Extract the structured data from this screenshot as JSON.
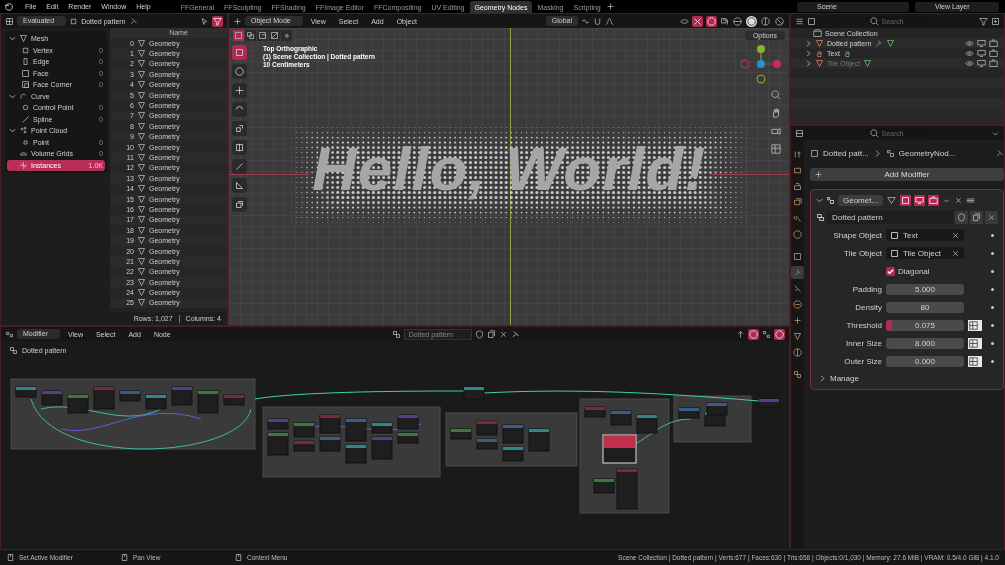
{
  "menu": [
    "File",
    "Edit",
    "Render",
    "Window",
    "Help"
  ],
  "workspaces": [
    {
      "label": "FFGeneral",
      "selected": false
    },
    {
      "label": "FFSculpting",
      "selected": false
    },
    {
      "label": "FFShading",
      "selected": false
    },
    {
      "label": "FFImage Editor",
      "selected": false
    },
    {
      "label": "FFCompositing",
      "selected": false
    },
    {
      "label": "UV Editing",
      "selected": false
    },
    {
      "label": "Geometry Nodes",
      "selected": true
    },
    {
      "label": "Masking",
      "selected": false
    },
    {
      "label": "Scripting",
      "selected": false
    }
  ],
  "scene": "Scene",
  "view_layer": "View Layer",
  "spreadsheet": {
    "display": "Evaluated",
    "object": "Dotted pattern",
    "tree": [
      {
        "label": "Mesh",
        "kind": "mesh",
        "expanded": true,
        "selected": false,
        "children": [
          {
            "label": "Vertex",
            "kind": "vertex",
            "count": "0",
            "selected": false
          },
          {
            "label": "Edge",
            "kind": "edge",
            "count": "0",
            "selected": false
          },
          {
            "label": "Face",
            "kind": "face",
            "count": "0",
            "selected": false
          },
          {
            "label": "Face Corner",
            "kind": "corner",
            "count": "0",
            "selected": false
          }
        ]
      },
      {
        "label": "Curve",
        "kind": "curve",
        "expanded": true,
        "selected": false,
        "children": [
          {
            "label": "Control Point",
            "kind": "control_point",
            "count": "0",
            "selected": false
          },
          {
            "label": "Spline",
            "kind": "spline",
            "count": "0",
            "selected": false
          }
        ]
      },
      {
        "label": "Point Cloud",
        "kind": "point_cloud",
        "expanded": true,
        "selected": false,
        "children": [
          {
            "label": "Point",
            "kind": "point",
            "count": "0",
            "selected": false
          }
        ]
      },
      {
        "label": "Volume Grids",
        "kind": "volume",
        "count": "0",
        "selected": false
      },
      {
        "label": "Instances",
        "kind": "instances",
        "count": "1.0K",
        "selected": true
      }
    ],
    "column": "Name",
    "rows": [
      {
        "index": "0",
        "name": "Geometry"
      },
      {
        "index": "1",
        "name": "Geometry"
      },
      {
        "index": "2",
        "name": "Geometry"
      },
      {
        "index": "3",
        "name": "Geometry"
      },
      {
        "index": "4",
        "name": "Geometry"
      },
      {
        "index": "5",
        "name": "Geometry"
      },
      {
        "index": "6",
        "name": "Geometry"
      },
      {
        "index": "7",
        "name": "Geometry"
      },
      {
        "index": "8",
        "name": "Geometry"
      },
      {
        "index": "9",
        "name": "Geometry"
      },
      {
        "index": "10",
        "name": "Geometry"
      },
      {
        "index": "11",
        "name": "Geometry"
      },
      {
        "index": "12",
        "name": "Geometry"
      },
      {
        "index": "13",
        "name": "Geometry"
      },
      {
        "index": "14",
        "name": "Geometry"
      },
      {
        "index": "15",
        "name": "Geometry"
      },
      {
        "index": "16",
        "name": "Geometry"
      },
      {
        "index": "17",
        "name": "Geometry"
      },
      {
        "index": "18",
        "name": "Geometry"
      },
      {
        "index": "19",
        "name": "Geometry"
      },
      {
        "index": "20",
        "name": "Geometry"
      },
      {
        "index": "21",
        "name": "Geometry"
      },
      {
        "index": "22",
        "name": "Geometry"
      },
      {
        "index": "23",
        "name": "Geometry"
      },
      {
        "index": "24",
        "name": "Geometry"
      },
      {
        "index": "25",
        "name": "Geometry"
      }
    ],
    "rows_count": "Rows: 1,027",
    "columns_count": "Columns: 4"
  },
  "viewport": {
    "mode": "Object Mode",
    "menus": [
      "View",
      "Select",
      "Add",
      "Object"
    ],
    "orientation": "Global",
    "options": "Options",
    "select_modes": [
      {
        "kind": "set",
        "selected": true
      },
      {
        "kind": "extend",
        "selected": false
      },
      {
        "kind": "subtract",
        "selected": false
      },
      {
        "kind": "invert",
        "selected": false
      },
      {
        "kind": "intersect",
        "selected": false
      }
    ],
    "shading": [
      {
        "kind": "wireframe",
        "selected": false
      },
      {
        "kind": "solid",
        "selected": true
      },
      {
        "kind": "material",
        "selected": false
      },
      {
        "kind": "rendered",
        "selected": false
      }
    ],
    "tools": [
      {
        "kind": "select",
        "selected": true
      },
      {
        "kind": "cursor",
        "selected": false
      },
      {
        "kind": "move",
        "selected": false
      },
      {
        "kind": "rotate",
        "selected": false
      },
      {
        "kind": "scale",
        "selected": false
      },
      {
        "kind": "transform",
        "selected": false
      },
      {
        "kind": "annotate",
        "selected": false
      },
      {
        "kind": "measure",
        "selected": false
      },
      {
        "kind": "add_cube",
        "selected": false
      }
    ],
    "view_name": "Top Orthographic",
    "collection": "(1) Scene Collection | Dotted pattern",
    "scale": "10 Centimeters",
    "text": "Hello, World!"
  },
  "outliner": {
    "search": {
      "placeholder": "Search"
    },
    "root": "Scene Collection",
    "items": [
      {
        "label": "Dotted pattern",
        "kind": "mesh",
        "disabled": false,
        "expanded": false
      },
      {
        "label": "Text",
        "kind": "text",
        "disabled": false,
        "expanded": false
      },
      {
        "label": "Tile Object",
        "kind": "mesh",
        "disabled": true,
        "expanded": false
      }
    ]
  },
  "properties": {
    "search": {
      "placeholder": "Search"
    },
    "tabs": [
      {
        "kind": "tool",
        "selected": false
      },
      {
        "kind": "render",
        "selected": false
      },
      {
        "kind": "output",
        "selected": false
      },
      {
        "kind": "view_layer",
        "selected": false
      },
      {
        "kind": "scene",
        "selected": false
      },
      {
        "kind": "world",
        "selected": false
      },
      {
        "kind": "object",
        "selected": false
      },
      {
        "kind": "modifiers",
        "selected": true
      },
      {
        "kind": "particles",
        "selected": false
      },
      {
        "kind": "physics",
        "selected": false
      },
      {
        "kind": "constraints",
        "selected": false
      },
      {
        "kind": "data",
        "selected": false
      },
      {
        "kind": "material",
        "selected": false
      },
      {
        "kind": "texture",
        "selected": false
      }
    ],
    "breadcrumb": [
      "Dotted patt...",
      "GeometryNod..."
    ],
    "add_modifier": "Add Modifier",
    "modifier": {
      "name": "Geomet...",
      "expanded": true,
      "toggles": [
        {
          "kind": "cage",
          "on": false
        },
        {
          "kind": "edit_mode",
          "on": true
        },
        {
          "kind": "viewport",
          "on": true
        },
        {
          "kind": "render",
          "on": true
        }
      ],
      "node_group": "Dotted pattern",
      "inputs": [
        {
          "label": "Shape Object",
          "kind": "object",
          "value": "Text"
        },
        {
          "label": "Tile Object",
          "kind": "object",
          "value": "Tile Object"
        },
        {
          "label": "Diagonal",
          "kind": "checkbox",
          "checked": true
        },
        {
          "label": "Padding",
          "kind": "number",
          "value": "5.000"
        },
        {
          "label": "Density",
          "kind": "number",
          "value": "80"
        },
        {
          "label": "Threshold",
          "kind": "slider",
          "value": "0.075",
          "level": 0.075,
          "attribute_toggle": true
        },
        {
          "label": "Inner Size",
          "kind": "number",
          "value": "8.000",
          "attribute_toggle": true
        },
        {
          "label": "Outer Size",
          "kind": "number",
          "value": "0.000",
          "attribute_toggle": true
        }
      ],
      "manage": "Manage"
    }
  },
  "node_editor": {
    "context": "Modifier",
    "menus": [
      "View",
      "Select",
      "Add",
      "Node"
    ],
    "group": "Dotted pattern",
    "breadcrumb": "Dotted pattern"
  },
  "status": {
    "hints": [
      "Set Active Modifier",
      "Pan View",
      "Context Menu"
    ],
    "info": "Scene Collection | Dotted pattern | Verts:677 | Faces:630 | Tris:658 | Objects:0/1,030 | Memory: 27.6 MiB | VRAM: 0.5/4.0 GiB | 4.1.0"
  }
}
